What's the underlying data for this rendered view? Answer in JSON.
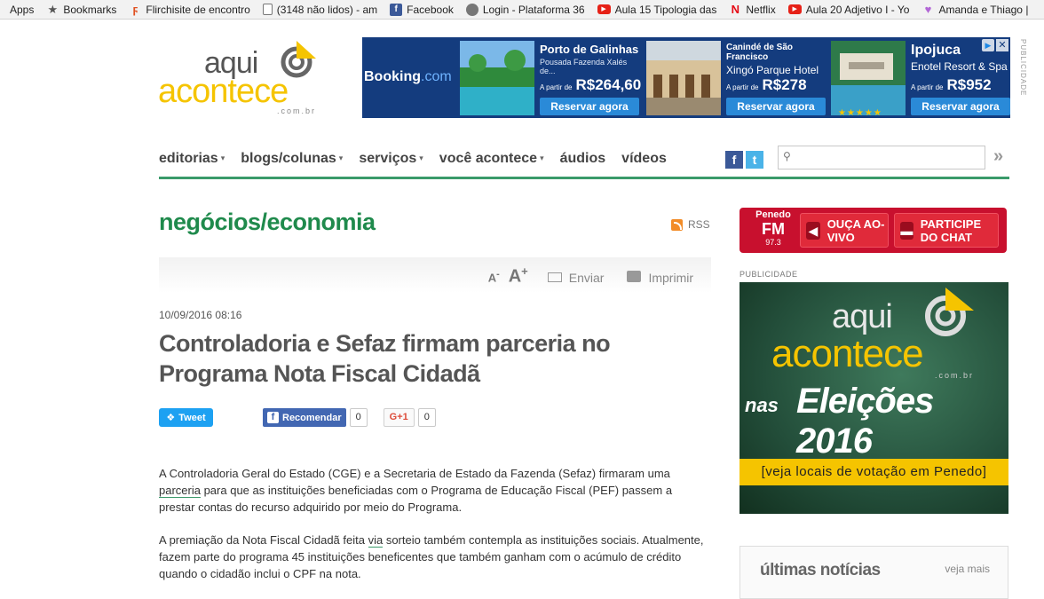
{
  "bookmarks": [
    {
      "icon": "apps-icon",
      "label": "Apps"
    },
    {
      "icon": "star-icon",
      "label": "Bookmarks"
    },
    {
      "icon": "flirchi-icon",
      "label": "Flirchisite de encontro"
    },
    {
      "icon": "document-icon",
      "label": "(3148 não lidos) - am"
    },
    {
      "icon": "facebook-icon",
      "label": "Facebook"
    },
    {
      "icon": "login-icon",
      "label": "Login - Plataforma 36"
    },
    {
      "icon": "youtube-icon",
      "label": "Aula 15 Tipologia das"
    },
    {
      "icon": "netflix-icon",
      "label": "Netflix"
    },
    {
      "icon": "youtube-icon",
      "label": "Aula 20 Adjetivo I - Yo"
    },
    {
      "icon": "heart-icon",
      "label": "Amanda e Thiago |"
    }
  ],
  "logo": {
    "aqui": "aqui",
    "acontece": "acontece",
    "domain": ".com.br"
  },
  "ad": {
    "brand": "Booking",
    "brand_suffix": ".com",
    "vertical_label": "PUBLICIDADE",
    "cards": [
      {
        "title": "Porto de Galinhas",
        "subtitle": "Pousada Fazenda Xalés de...",
        "from": "A partir de",
        "price": "R$264,60",
        "cta": "Reservar agora"
      },
      {
        "title": "Canindé de São Francisco",
        "subtitle": "Xingó Parque Hotel",
        "from": "A partir de",
        "price": "R$278",
        "cta": "Reservar agora"
      },
      {
        "title": "Ipojuca",
        "subtitle": "Enotel Resort & Spa",
        "from": "A partir de",
        "price": "R$952",
        "cta": "Reservar agora",
        "stars": "★★★★★"
      }
    ]
  },
  "nav": {
    "items": [
      {
        "label": "editorias",
        "dropdown": true
      },
      {
        "label": "blogs/colunas",
        "dropdown": true
      },
      {
        "label": "serviços",
        "dropdown": true
      },
      {
        "label": "você acontece",
        "dropdown": true
      },
      {
        "label": "áudios",
        "dropdown": false
      },
      {
        "label": "vídeos",
        "dropdown": false
      }
    ],
    "search_placeholder": ""
  },
  "section": {
    "title": "negócios/economia",
    "rss": "RSS"
  },
  "tools": {
    "font_small": "A",
    "font_small_sign": "-",
    "font_big": "A",
    "font_big_sign": "+",
    "send": "Enviar",
    "print": "Imprimir"
  },
  "article": {
    "date": "10/09/2016 08:16",
    "title": "Controladoria e Sefaz firmam parceria no Programa Nota Fiscal Cidadã",
    "share": {
      "tweet": "Tweet",
      "recommend": "Recomendar",
      "fb_count": "0",
      "gplus": "G+1",
      "gplus_count": "0"
    },
    "p1_a": "A Controladoria Geral do Estado (CGE) e a Secretaria de Estado da Fazenda (Sefaz) firmaram uma ",
    "p1_link": "parceria",
    "p1_b": " para que as instituições beneficiadas com o Programa de Educação Fiscal (PEF) passem a prestar contas do recurso adquirido por meio do Programa.",
    "p2_a": "A premiação da Nota Fiscal Cidadã feita ",
    "p2_link": "via",
    "p2_b": " sorteio também contempla as instituições sociais. Atualmente, fazem parte do programa 45 instituições beneficentes que também ganham com o acúmulo de crédito quando o cidadão inclui o CPF na nota."
  },
  "radio": {
    "brand_top": "Penedo",
    "brand_mid": "FM",
    "brand_freq": "97.3",
    "listen": "OUÇA AO-VIVO",
    "chat": "PARTICIPE DO CHAT"
  },
  "sidebar": {
    "pub_label": "PUBLICIDADE",
    "promo": {
      "aqui": "aqui",
      "acontece": "acontece",
      "domain": ".com.br",
      "nas": "nas",
      "eleicoes": "Eleições 2016",
      "strip": "[veja locais de votação em Penedo]"
    },
    "latest": {
      "title": "últimas notícias",
      "more": "veja mais"
    }
  },
  "colors": {
    "brand_green": "#1f8a4c",
    "brand_yellow": "#f5c400",
    "booking_blue": "#143c7e",
    "radio_red": "#c8102e"
  }
}
